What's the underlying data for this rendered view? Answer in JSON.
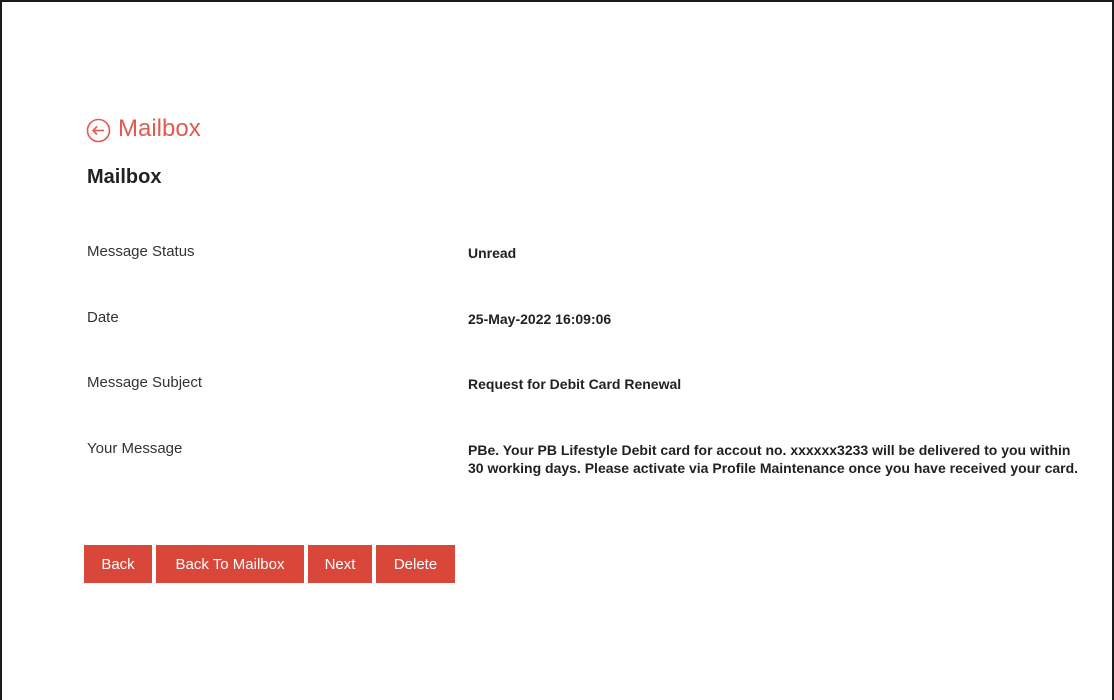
{
  "header": {
    "back_link_label": "Mailbox",
    "back_icon": "circle-arrow-left-icon",
    "page_title": "Mailbox",
    "accent_color": "#e05a4f"
  },
  "details": {
    "status": {
      "label": "Message Status",
      "value": "Unread"
    },
    "date": {
      "label": "Date",
      "value": "25-May-2022 16:09:06"
    },
    "subject": {
      "label": "Message Subject",
      "value": "Request for Debit Card Renewal"
    },
    "message": {
      "label": "Your Message",
      "value": "PBe. Your PB Lifestyle Debit card for accout no. xxxxxx3233 will be delivered to you within 30 working days. Please activate via Profile Maintenance once you have received your card."
    }
  },
  "actions": {
    "back": "Back",
    "back_to_mailbox": "Back To Mailbox",
    "next": "Next",
    "delete": "Delete",
    "button_color": "#d9473a"
  }
}
